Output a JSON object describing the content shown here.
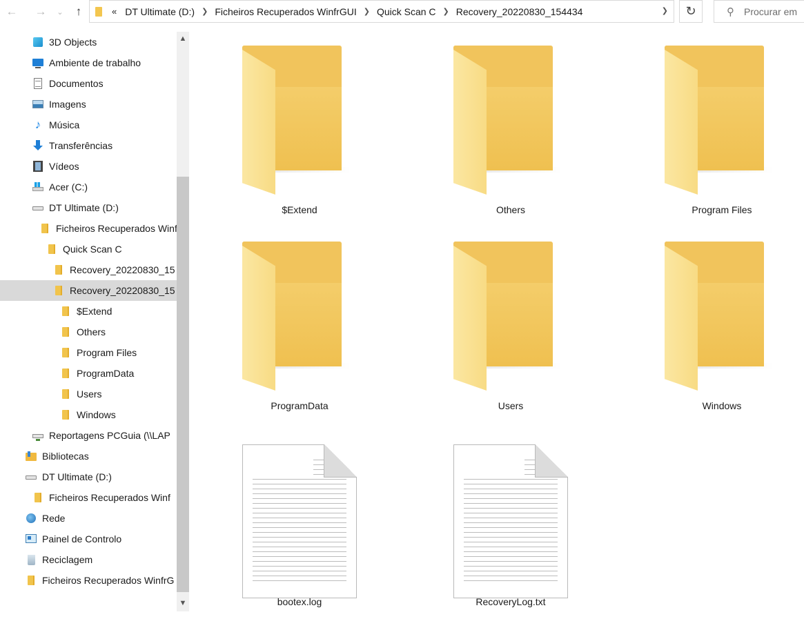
{
  "addressbar": {
    "overflow_label": "«",
    "breadcrumbs": [
      "DT Ultimate (D:)",
      "Ficheiros Recuperados WinfrGUI",
      "Quick Scan C",
      "Recovery_20220830_154434"
    ],
    "search_placeholder": "Procurar em"
  },
  "sidebar": {
    "items": [
      {
        "label": "3D Objects",
        "icon": "3d-objects-icon"
      },
      {
        "label": "Ambiente de trabalho",
        "icon": "desktop-icon"
      },
      {
        "label": "Documentos",
        "icon": "documents-icon"
      },
      {
        "label": "Imagens",
        "icon": "pictures-icon"
      },
      {
        "label": "Música",
        "icon": "music-icon"
      },
      {
        "label": "Transferências",
        "icon": "downloads-icon"
      },
      {
        "label": "Vídeos",
        "icon": "videos-icon"
      },
      {
        "label": "Acer (C:)",
        "icon": "windows-drive-icon"
      },
      {
        "label": "DT Ultimate (D:)",
        "icon": "drive-icon"
      },
      {
        "label": "Ficheiros Recuperados Winf",
        "icon": "folder-icon"
      },
      {
        "label": "Quick Scan C",
        "icon": "folder-icon"
      },
      {
        "label": "Recovery_20220830_15",
        "icon": "folder-icon"
      },
      {
        "label": "Recovery_20220830_15",
        "icon": "folder-icon",
        "selected": true
      },
      {
        "label": "$Extend",
        "icon": "folder-icon"
      },
      {
        "label": "Others",
        "icon": "folder-icon"
      },
      {
        "label": "Program Files",
        "icon": "folder-icon"
      },
      {
        "label": "ProgramData",
        "icon": "folder-icon"
      },
      {
        "label": "Users",
        "icon": "folder-icon"
      },
      {
        "label": "Windows",
        "icon": "folder-icon"
      },
      {
        "label": "Reportagens PCGuia (\\\\LAP",
        "icon": "network-drive-icon"
      },
      {
        "label": "Bibliotecas",
        "icon": "libraries-icon"
      },
      {
        "label": "DT Ultimate (D:)",
        "icon": "drive-icon"
      },
      {
        "label": "Ficheiros Recuperados Winf",
        "icon": "folder-icon"
      },
      {
        "label": "Rede",
        "icon": "network-icon"
      },
      {
        "label": "Painel de Controlo",
        "icon": "control-panel-icon"
      },
      {
        "label": "Reciclagem",
        "icon": "recycle-bin-icon"
      },
      {
        "label": "Ficheiros Recuperados WinfrG",
        "icon": "folder-icon"
      }
    ]
  },
  "content": {
    "items": [
      {
        "name": "$Extend",
        "type": "folder"
      },
      {
        "name": "Others",
        "type": "folder"
      },
      {
        "name": "Program Files",
        "type": "folder"
      },
      {
        "name": "ProgramData",
        "type": "folder"
      },
      {
        "name": "Users",
        "type": "folder"
      },
      {
        "name": "Windows",
        "type": "folder"
      },
      {
        "name": "bootex.log",
        "type": "file"
      },
      {
        "name": "RecoveryLog.txt",
        "type": "file"
      }
    ]
  },
  "colors": {
    "folder": "#f1c45c",
    "selection": "#d9d9d9"
  }
}
